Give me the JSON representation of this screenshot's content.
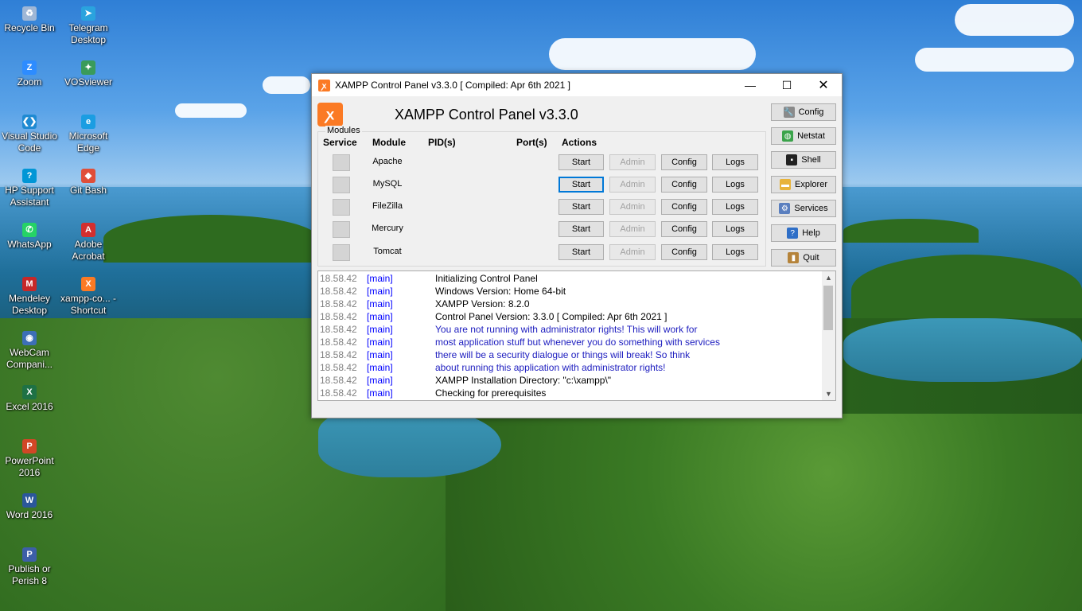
{
  "desktop": {
    "icons": [
      {
        "label": "Recycle Bin",
        "icon": "recycle-bin-icon",
        "color": "#9fb7d6",
        "glyph": "♻"
      },
      {
        "label": "Telegram Desktop",
        "icon": "telegram-icon",
        "color": "#2aa3de",
        "glyph": "➤"
      },
      {
        "label": "Zoom",
        "icon": "zoom-icon",
        "color": "#2d8cff",
        "glyph": "Z"
      },
      {
        "label": "VOSviewer",
        "icon": "vosviewer-icon",
        "color": "#3a9b5a",
        "glyph": "✦"
      },
      {
        "label": "Visual Studio Code",
        "icon": "vscode-icon",
        "color": "#1f8ad2",
        "glyph": "❮❯"
      },
      {
        "label": "Microsoft Edge",
        "icon": "edge-icon",
        "color": "#1b9de2",
        "glyph": "e"
      },
      {
        "label": "HP Support Assistant",
        "icon": "hp-support-icon",
        "color": "#0096d6",
        "glyph": "?"
      },
      {
        "label": "Git Bash",
        "icon": "git-bash-icon",
        "color": "#e04e39",
        "glyph": "◆"
      },
      {
        "label": "WhatsApp",
        "icon": "whatsapp-icon",
        "color": "#25d366",
        "glyph": "✆"
      },
      {
        "label": "Adobe Acrobat",
        "icon": "acrobat-icon",
        "color": "#d32f2f",
        "glyph": "A"
      },
      {
        "label": "Mendeley Desktop",
        "icon": "mendeley-icon",
        "color": "#c62828",
        "glyph": "M"
      },
      {
        "label": "xampp-co... - Shortcut",
        "icon": "xampp-shortcut-icon",
        "color": "#fb7a24",
        "glyph": "X"
      },
      {
        "label": "WebCam Compani...",
        "icon": "webcam-icon",
        "color": "#3d6fb6",
        "glyph": "◉"
      },
      {
        "label": "Excel 2016",
        "icon": "excel-icon",
        "color": "#1e7145",
        "glyph": "X"
      },
      {
        "label": "PowerPoint 2016",
        "icon": "powerpoint-icon",
        "color": "#d24726",
        "glyph": "P"
      },
      {
        "label": "Word 2016",
        "icon": "word-icon",
        "color": "#2b579a",
        "glyph": "W"
      },
      {
        "label": "Publish or Perish 8",
        "icon": "publish-or-perish-icon",
        "color": "#3d5fa8",
        "glyph": "P"
      }
    ]
  },
  "window": {
    "title": "XAMPP Control Panel v3.3.0   [ Compiled: Apr 6th 2021 ]",
    "header_title": "XAMPP Control Panel v3.3.0",
    "modules_legend": "Modules",
    "columns": {
      "service": "Service",
      "module": "Module",
      "pid": "PID(s)",
      "port": "Port(s)",
      "actions": "Actions"
    },
    "modules": [
      {
        "name": "Apache",
        "start": "Start",
        "admin": "Admin",
        "config": "Config",
        "logs": "Logs"
      },
      {
        "name": "MySQL",
        "start": "Start",
        "admin": "Admin",
        "config": "Config",
        "logs": "Logs"
      },
      {
        "name": "FileZilla",
        "start": "Start",
        "admin": "Admin",
        "config": "Config",
        "logs": "Logs"
      },
      {
        "name": "Mercury",
        "start": "Start",
        "admin": "Admin",
        "config": "Config",
        "logs": "Logs"
      },
      {
        "name": "Tomcat",
        "start": "Start",
        "admin": "Admin",
        "config": "Config",
        "logs": "Logs"
      }
    ],
    "side_buttons": [
      {
        "label": "Config",
        "icon": "wrench-icon"
      },
      {
        "label": "Netstat",
        "icon": "globe-icon"
      },
      {
        "label": "Shell",
        "icon": "terminal-icon"
      },
      {
        "label": "Explorer",
        "icon": "folder-icon"
      },
      {
        "label": "Services",
        "icon": "services-icon"
      },
      {
        "label": "Help",
        "icon": "help-icon"
      },
      {
        "label": "Quit",
        "icon": "quit-icon"
      }
    ],
    "log": [
      {
        "time": "18.58.42",
        "src": "[main]",
        "msg": "Initializing Control Panel",
        "warn": false
      },
      {
        "time": "18.58.42",
        "src": "[main]",
        "msg": "Windows Version:  Home  64-bit",
        "warn": false
      },
      {
        "time": "18.58.42",
        "src": "[main]",
        "msg": "XAMPP Version: 8.2.0",
        "warn": false
      },
      {
        "time": "18.58.42",
        "src": "[main]",
        "msg": "Control Panel Version: 3.3.0  [ Compiled: Apr 6th 2021 ]",
        "warn": false
      },
      {
        "time": "18.58.42",
        "src": "[main]",
        "msg": "You are not running with administrator rights! This will work for",
        "warn": true
      },
      {
        "time": "18.58.42",
        "src": "[main]",
        "msg": "most application stuff but whenever you do something with services",
        "warn": true
      },
      {
        "time": "18.58.42",
        "src": "[main]",
        "msg": "there will be a security dialogue or things will break! So think",
        "warn": true
      },
      {
        "time": "18.58.42",
        "src": "[main]",
        "msg": "about running this application with administrator rights!",
        "warn": true
      },
      {
        "time": "18.58.42",
        "src": "[main]",
        "msg": "XAMPP Installation Directory: \"c:\\xampp\\\"",
        "warn": false
      },
      {
        "time": "18.58.42",
        "src": "[main]",
        "msg": "Checking for prerequisites",
        "warn": false
      }
    ]
  }
}
